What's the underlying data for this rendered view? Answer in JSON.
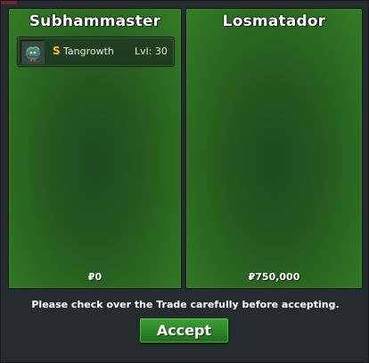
{
  "trade": {
    "left_panel": {
      "player_name": "Subhammaster",
      "money": "₽0",
      "items": [
        {
          "icon": "tangrowth-icon",
          "currency_icon": "S",
          "name": "Tangrowth",
          "level": "Lvl: 30"
        }
      ]
    },
    "right_panel": {
      "player_name": "Losmatador",
      "money": "₽750,000",
      "items": []
    },
    "notice": "Please check over the Trade carefully before accepting.",
    "accept_label": "Accept"
  },
  "colors": {
    "panel_green": "#2c6b22",
    "button_green": "#2f8a29",
    "coin_gold": "#f2c21b",
    "background": "#262b2f"
  }
}
